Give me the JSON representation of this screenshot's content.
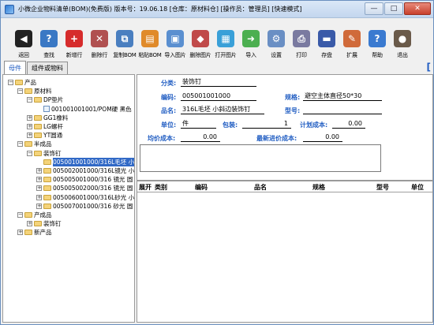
{
  "window": {
    "title": "小微企业物料清单(BOM)(免费版)  版本号：19.06.18  [仓库：原材料仓]  [操作员：管理员]  [快速模式]",
    "minimize": "—",
    "maximize": "□",
    "close": "✕"
  },
  "toolbar": [
    {
      "name": "back",
      "label": "返回",
      "icon": "back-icon",
      "color": "#222222",
      "glyph": "◀"
    },
    {
      "name": "search",
      "label": "查找",
      "icon": "search-icon",
      "color": "#3a78c4",
      "glyph": "?"
    },
    {
      "name": "add",
      "label": "新增行",
      "icon": "add-icon",
      "color": "#d62c2c",
      "glyph": "+"
    },
    {
      "name": "delete-row",
      "label": "删除行",
      "icon": "delete-row-icon",
      "color": "#b05050",
      "glyph": "✕"
    },
    {
      "name": "copy-bom",
      "label": "复制BOM",
      "icon": "copy-icon",
      "color": "#4a7fc0",
      "glyph": "⧉"
    },
    {
      "name": "paste-bom",
      "label": "粘贴BOM",
      "icon": "paste-icon",
      "color": "#e08a2a",
      "glyph": "▤"
    },
    {
      "name": "import-image",
      "label": "导入图片",
      "icon": "image-icon",
      "color": "#5a8fd0",
      "glyph": "▣"
    },
    {
      "name": "delete-image",
      "label": "删除图片",
      "icon": "delete-image-icon",
      "color": "#c04a4a",
      "glyph": "◆"
    },
    {
      "name": "open-image",
      "label": "打开图片",
      "icon": "open-image-icon",
      "color": "#3aa0d8",
      "glyph": "▦"
    },
    {
      "name": "import",
      "label": "导入",
      "icon": "import-icon",
      "color": "#4caf50",
      "glyph": "➜"
    },
    {
      "name": "settings",
      "label": "设置",
      "icon": "settings-icon",
      "color": "#6a8fc4",
      "glyph": "⚙"
    },
    {
      "name": "print",
      "label": "打印",
      "icon": "print-icon",
      "color": "#7a7aa0",
      "glyph": "⎙"
    },
    {
      "name": "save",
      "label": "存盘",
      "icon": "save-icon",
      "color": "#3a5aa8",
      "glyph": "▬"
    },
    {
      "name": "extend",
      "label": "扩展",
      "icon": "extend-icon",
      "color": "#d06a3a",
      "glyph": "✎"
    },
    {
      "name": "help",
      "label": "帮助",
      "icon": "help-icon",
      "color": "#3a7ad0",
      "glyph": "?"
    },
    {
      "name": "exit",
      "label": "退出",
      "icon": "exit-icon",
      "color": "#6a5a4a",
      "glyph": "●"
    }
  ],
  "tabs": [
    {
      "label": "母件",
      "active": true
    },
    {
      "label": "组件或物料",
      "active": false
    }
  ],
  "bracket": "[",
  "tree": [
    {
      "label": "产品",
      "level": 0,
      "toggle": "−",
      "kind": "folder"
    },
    {
      "label": "原材料",
      "level": 1,
      "toggle": "−",
      "kind": "folder"
    },
    {
      "label": "DP垫片",
      "level": 2,
      "toggle": "−",
      "kind": "folder"
    },
    {
      "label": "001001001001/POM硬 黑色",
      "level": 3,
      "toggle": "",
      "kind": "doc"
    },
    {
      "label": "GG1橡料",
      "level": 2,
      "toggle": "+",
      "kind": "folder"
    },
    {
      "label": "LG螺杆",
      "level": 2,
      "toggle": "+",
      "kind": "folder"
    },
    {
      "label": "YT圆通",
      "level": 2,
      "toggle": "+",
      "kind": "folder"
    },
    {
      "label": "半成品",
      "level": 1,
      "toggle": "−",
      "kind": "folder"
    },
    {
      "label": "装饰钉",
      "level": 2,
      "toggle": "−",
      "kind": "folder"
    },
    {
      "label": "005001001000/316L毛坯 小",
      "level": 3,
      "toggle": "",
      "kind": "folder",
      "selected": true
    },
    {
      "label": "005002001000/316L镜光 小",
      "level": 3,
      "toggle": "+",
      "kind": "folder"
    },
    {
      "label": "005005001000/316 镜光 圆",
      "level": 3,
      "toggle": "+",
      "kind": "folder"
    },
    {
      "label": "005005002000/316 镜光 圆",
      "level": 3,
      "toggle": "+",
      "kind": "folder"
    },
    {
      "label": "005006001000/316L砂光 小",
      "level": 3,
      "toggle": "+",
      "kind": "folder"
    },
    {
      "label": "005007001000/316 砂光 圆",
      "level": 3,
      "toggle": "+",
      "kind": "folder"
    },
    {
      "label": "产成品",
      "level": 1,
      "toggle": "−",
      "kind": "folder"
    },
    {
      "label": "装饰钉",
      "level": 2,
      "toggle": "+",
      "kind": "folder"
    },
    {
      "label": "新产品",
      "level": 1,
      "toggle": "+",
      "kind": "folder"
    }
  ],
  "detail": {
    "category_label": "分类:",
    "category": "装饰钉",
    "code_label": "编码:",
    "code": "005001001000",
    "spec_label": "规格:",
    "spec": "避空主体直径50*30",
    "name_label": "品名:",
    "name": "316L毛坯 小斜边装饰钉",
    "model_label": "型号:",
    "model": "",
    "unit_label": "单位:",
    "unit": "件",
    "pack_label": "包装:",
    "pack": "1",
    "plan_cost_label": "计划成本:",
    "plan_cost": "0.00",
    "avg_cost_label": "均价成本:",
    "avg_cost": "0.00",
    "last_cost_label": "最新进价成本:",
    "last_cost": "0.00"
  },
  "grid": {
    "columns": [
      "展开",
      "类别",
      "编码",
      "品名",
      "规格",
      "型号",
      "单位"
    ]
  }
}
